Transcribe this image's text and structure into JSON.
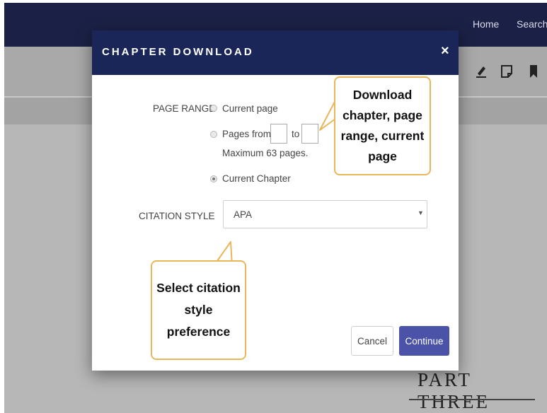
{
  "nav": {
    "home": "Home",
    "search": "Search"
  },
  "toolbar": {
    "icons": [
      "highlighter-icon",
      "note-icon",
      "bookmark-icon"
    ]
  },
  "page": {
    "part_title": "PART THREE"
  },
  "modal": {
    "title": "CHAPTER DOWNLOAD",
    "close": "×",
    "page_range_label": "PAGE RANGE",
    "options": {
      "current_page": "Current page",
      "pages_from": "Pages from",
      "to": "to",
      "max_note": "Maximum 63 pages.",
      "current_chapter": "Current Chapter",
      "selected": "current_chapter"
    },
    "citation_label": "CITATION STYLE",
    "citation_value": "APA",
    "cancel": "Cancel",
    "continue": "Continue"
  },
  "callouts": {
    "download": [
      "Download",
      "chapter, page",
      "range, current",
      "page"
    ],
    "citation": [
      "Select citation",
      "style",
      "preference"
    ]
  },
  "colors": {
    "header": "#1b2658",
    "nav": "#1b2146",
    "primary_button": "#4b53a8",
    "callout_border": "#eab65a"
  }
}
